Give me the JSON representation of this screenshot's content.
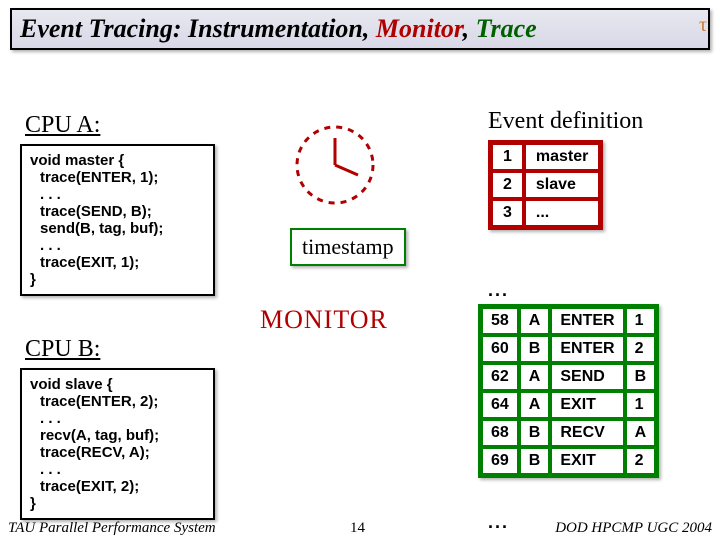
{
  "title": {
    "w1": "Event Tracing:",
    "w2a": "Instrumentation",
    "c1": ", ",
    "w2b": "Monitor",
    "c2": ", ",
    "w3": "Trace"
  },
  "cpuA": {
    "label": "CPU A:",
    "lines": [
      "void master {",
      " trace(ENTER, 1);",
      " . . .",
      " trace(SEND, B);",
      " send(B, tag, buf);",
      " . . .",
      " trace(EXIT, 1);",
      "}"
    ]
  },
  "cpuB": {
    "label": "CPU B:",
    "lines": [
      "void slave {",
      " trace(ENTER, 2);",
      " . . .",
      " recv(A, tag, buf);",
      " trace(RECV, A);",
      " . . .",
      " trace(EXIT, 2);",
      "}"
    ]
  },
  "timestamp_label": "timestamp",
  "monitor_label": "MONITOR",
  "event_def": {
    "title": "Event definition",
    "rows": [
      {
        "id": "1",
        "name": "master"
      },
      {
        "id": "2",
        "name": "slave"
      },
      {
        "id": "3",
        "name": "..."
      }
    ]
  },
  "trace": {
    "ell": "...",
    "rows": [
      {
        "t": "58",
        "cpu": "A",
        "ev": "ENTER",
        "arg": "1"
      },
      {
        "t": "60",
        "cpu": "B",
        "ev": "ENTER",
        "arg": "2"
      },
      {
        "t": "62",
        "cpu": "A",
        "ev": "SEND",
        "arg": "B"
      },
      {
        "t": "64",
        "cpu": "A",
        "ev": "EXIT",
        "arg": "1"
      },
      {
        "t": "68",
        "cpu": "B",
        "ev": "RECV",
        "arg": "A"
      },
      {
        "t": "69",
        "cpu": "B",
        "ev": "EXIT",
        "arg": "2"
      }
    ],
    "ell2": "..."
  },
  "footer": {
    "left": "TAU Parallel Performance System",
    "mid": "14",
    "right": "DOD HPCMP UGC 2004"
  },
  "logo": "τ"
}
